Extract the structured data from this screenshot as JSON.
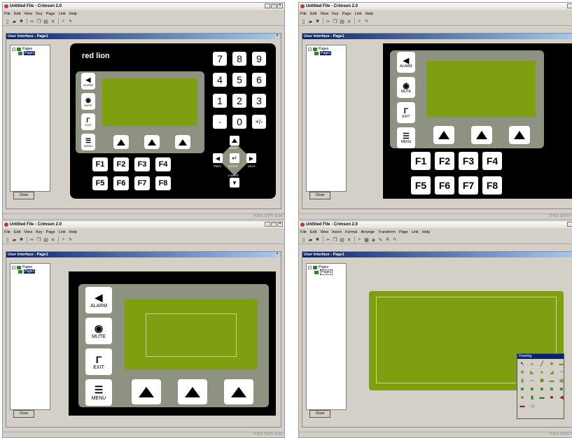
{
  "window_title": "Untitled File - Crimson 2.0",
  "window_controls": [
    "_",
    "□",
    "×"
  ],
  "menus_basic": [
    "File",
    "Edit",
    "View",
    "Key",
    "Page",
    "Link",
    "Help"
  ],
  "menus_drawing": [
    "File",
    "Edit",
    "View",
    "Insert",
    "Format",
    "Arrange",
    "Transform",
    "Page",
    "Link",
    "Help"
  ],
  "toolbar_icons": [
    "new-icon",
    "open-icon",
    "save-icon",
    "cut-icon",
    "copy-icon",
    "paste-icon",
    "delete-icon",
    "zoom-icon",
    "lightning-icon"
  ],
  "doc_title": "User Interface - Page1",
  "doc_close": "×",
  "tree": {
    "root": "Pages",
    "child": "Page1",
    "expander": "−"
  },
  "close_button": "Close",
  "status": "OVER CAPS NUM",
  "brand_logo": "red lion",
  "keypad": [
    "7",
    "8",
    "9",
    "4",
    "5",
    "6",
    "1",
    "2",
    "3",
    "·",
    "0",
    "+/-"
  ],
  "side_keys": [
    "ALARM",
    "MUTE",
    "EXIT",
    "MENU"
  ],
  "fkeys": [
    "F1",
    "F2",
    "F3",
    "F4",
    "F5",
    "F6",
    "F7",
    "F8"
  ],
  "nav": {
    "raise": "RAISE",
    "prev": "PREV",
    "enter": "ENTER",
    "next": "NEXT",
    "lower": "LOWER"
  },
  "palette_title": "Drawing",
  "colors": {
    "lcd": "#7ea010",
    "bezel": "#8e9280",
    "title_blue": "#0a246a"
  }
}
